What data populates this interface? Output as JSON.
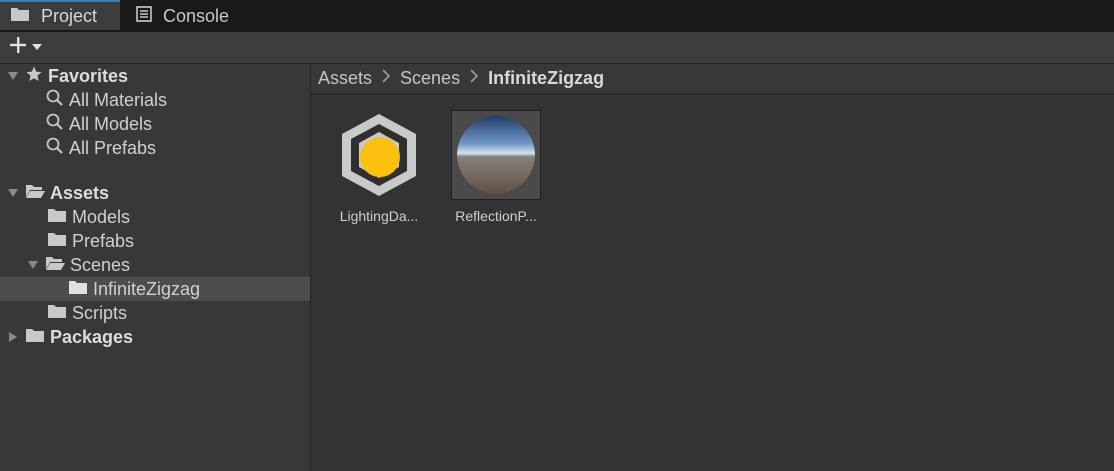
{
  "tabs": [
    {
      "label": "Project",
      "icon": "folder-icon",
      "active": true
    },
    {
      "label": "Console",
      "icon": "console-icon",
      "active": false
    }
  ],
  "toolbar": {
    "add_icon": "plus-icon",
    "dropdown_icon": "chevron-down-icon"
  },
  "tree": {
    "favorites": {
      "label": "Favorites",
      "items": [
        "All Materials",
        "All Models",
        "All Prefabs"
      ]
    },
    "assets": {
      "label": "Assets",
      "children": {
        "models": "Models",
        "prefabs": "Prefabs",
        "scenes": "Scenes",
        "infinite_zigzag": "InfiniteZigzag",
        "scripts": "Scripts"
      }
    },
    "packages": {
      "label": "Packages"
    }
  },
  "breadcrumb": {
    "items": [
      "Assets",
      "Scenes"
    ],
    "current": "InfiniteZigzag"
  },
  "assets_grid": [
    {
      "label": "LightingDa...",
      "icon": "lighting-data-icon"
    },
    {
      "label": "ReflectionP...",
      "icon": "reflection-probe-icon"
    }
  ],
  "colors": {
    "accent": "#3a79bb",
    "lighting_icon_yellow": "#fbbf0e",
    "selection": "#4d4d4d"
  }
}
